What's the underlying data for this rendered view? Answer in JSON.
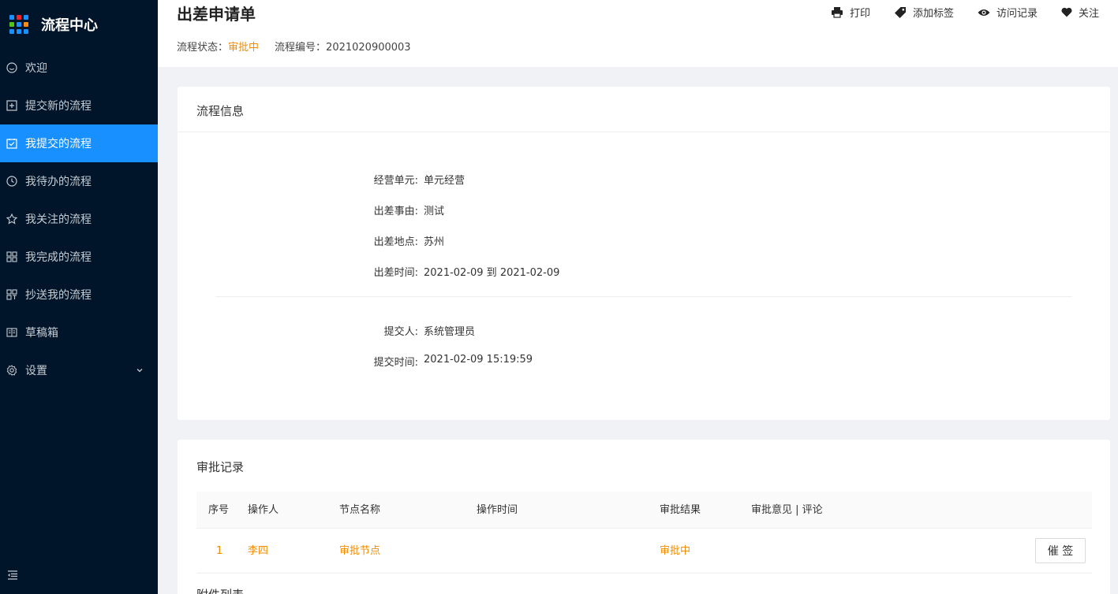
{
  "sidebar": {
    "title": "流程中心",
    "brand_colors": [
      "#1890ff",
      "#f5222d",
      "#1890ff",
      "#52c41a",
      "#1890ff",
      "#fa8c16",
      "#1890ff",
      "#1890ff",
      "#1890ff"
    ],
    "items": [
      {
        "label": "欢迎",
        "icon": "smile-icon"
      },
      {
        "label": "提交新的流程",
        "icon": "plus-square-icon"
      },
      {
        "label": "我提交的流程",
        "icon": "check-square-icon",
        "active": true
      },
      {
        "label": "我待办的流程",
        "icon": "clock-icon"
      },
      {
        "label": "我关注的流程",
        "icon": "star-icon"
      },
      {
        "label": "我完成的流程",
        "icon": "appstore-icon"
      },
      {
        "label": "抄送我的流程",
        "icon": "copy-icon"
      },
      {
        "label": "草稿箱",
        "icon": "book-icon"
      },
      {
        "label": "设置",
        "icon": "gear-icon"
      }
    ]
  },
  "header": {
    "title": "出差申请单",
    "status_label": "流程状态：",
    "status_value": "审批中",
    "number_label": "流程编号：",
    "number_value": "2021020900003",
    "actions": {
      "print": "打印",
      "tag": "添加标签",
      "visits": "访问记录",
      "follow": "关注"
    }
  },
  "info": {
    "title": "流程信息",
    "fields": [
      {
        "label": "经营单元:",
        "value": "单元经营"
      },
      {
        "label": "出差事由:",
        "value": "测试"
      },
      {
        "label": "出差地点:",
        "value": "苏州"
      },
      {
        "label": "出差时间:",
        "value": "2021-02-09 到 2021-02-09"
      },
      {
        "label": "提交人:",
        "value": "系统管理员"
      },
      {
        "label": "提交时间:",
        "value": "2021-02-09 15:19:59"
      }
    ]
  },
  "records": {
    "title": "审批记录",
    "columns": [
      "序号",
      "操作人",
      "节点名称",
      "操作时间",
      "审批结果",
      "审批意见 | 评论"
    ],
    "rows": [
      {
        "index": "1",
        "operator": "李四",
        "node": "审批节点",
        "time": "",
        "result": "审批中",
        "comment": ""
      }
    ],
    "urge_button": "催 签",
    "attachments_title": "附件列表"
  },
  "colors": {
    "sidebar_bg": "#001529",
    "active": "#1890ff",
    "accent_orange": "#f08c00"
  }
}
